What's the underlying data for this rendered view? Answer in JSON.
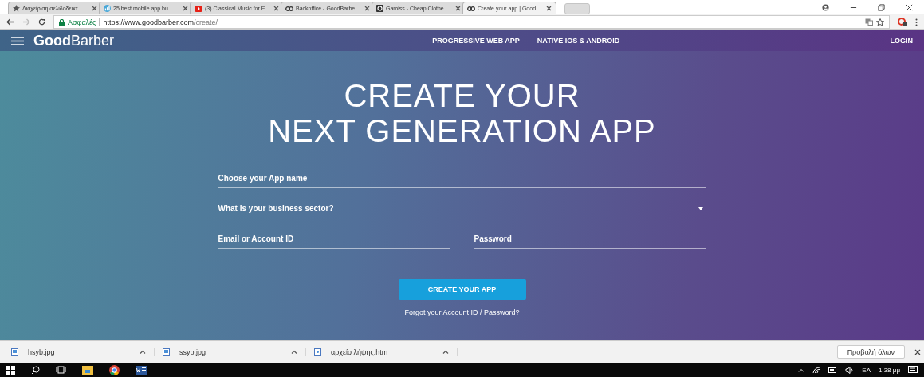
{
  "browser": {
    "tabs": [
      {
        "title": "Διαχείριση σελιδοδεικτ",
        "kind": "star",
        "selected": false
      },
      {
        "title": "25 best mobile app bu",
        "kind": "chart",
        "selected": false
      },
      {
        "title": "(3) Classical Music for E",
        "kind": "video",
        "selected": false
      },
      {
        "title": "Backoffice - GoodBarbe",
        "kind": "gb",
        "selected": false
      },
      {
        "title": "Gamiss - Cheap Clothe",
        "kind": "g",
        "selected": false
      },
      {
        "title": "Create your app | Good",
        "kind": "gb",
        "selected": true
      }
    ],
    "address": {
      "secure_label": "Ασφαλές",
      "url_host": "https://www.goodbarber.com",
      "url_path": "/create/"
    }
  },
  "site": {
    "logo": "**Good**Barber",
    "nav": [
      "PROGRESSIVE WEB APP",
      "NATIVE IOS & ANDROID"
    ],
    "login": "LOGIN",
    "heading": [
      "CREATE YOUR",
      "NEXT GENERATION APP"
    ],
    "fields": [
      {
        "placeholder": "Choose your App name",
        "kind": "text"
      },
      {
        "placeholder": "What is your business sector?",
        "kind": "select"
      }
    ],
    "credentials": [
      {
        "placeholder": "Email or Account ID"
      },
      {
        "placeholder": "Password"
      }
    ],
    "submit": "CREATE YOUR APP",
    "forgot": "Forgot your Account ID / Password?"
  },
  "downloads": {
    "items": [
      {
        "name": "hsyb.jpg",
        "kind": "image"
      },
      {
        "name": "ssyb.jpg",
        "kind": "image"
      },
      {
        "name": "αρχείο λήψης.htm",
        "kind": "page"
      }
    ],
    "show_all": "Προβολή όλων"
  },
  "taskbar": {
    "language": "ΕΛ",
    "time": "1:38 μμ"
  }
}
